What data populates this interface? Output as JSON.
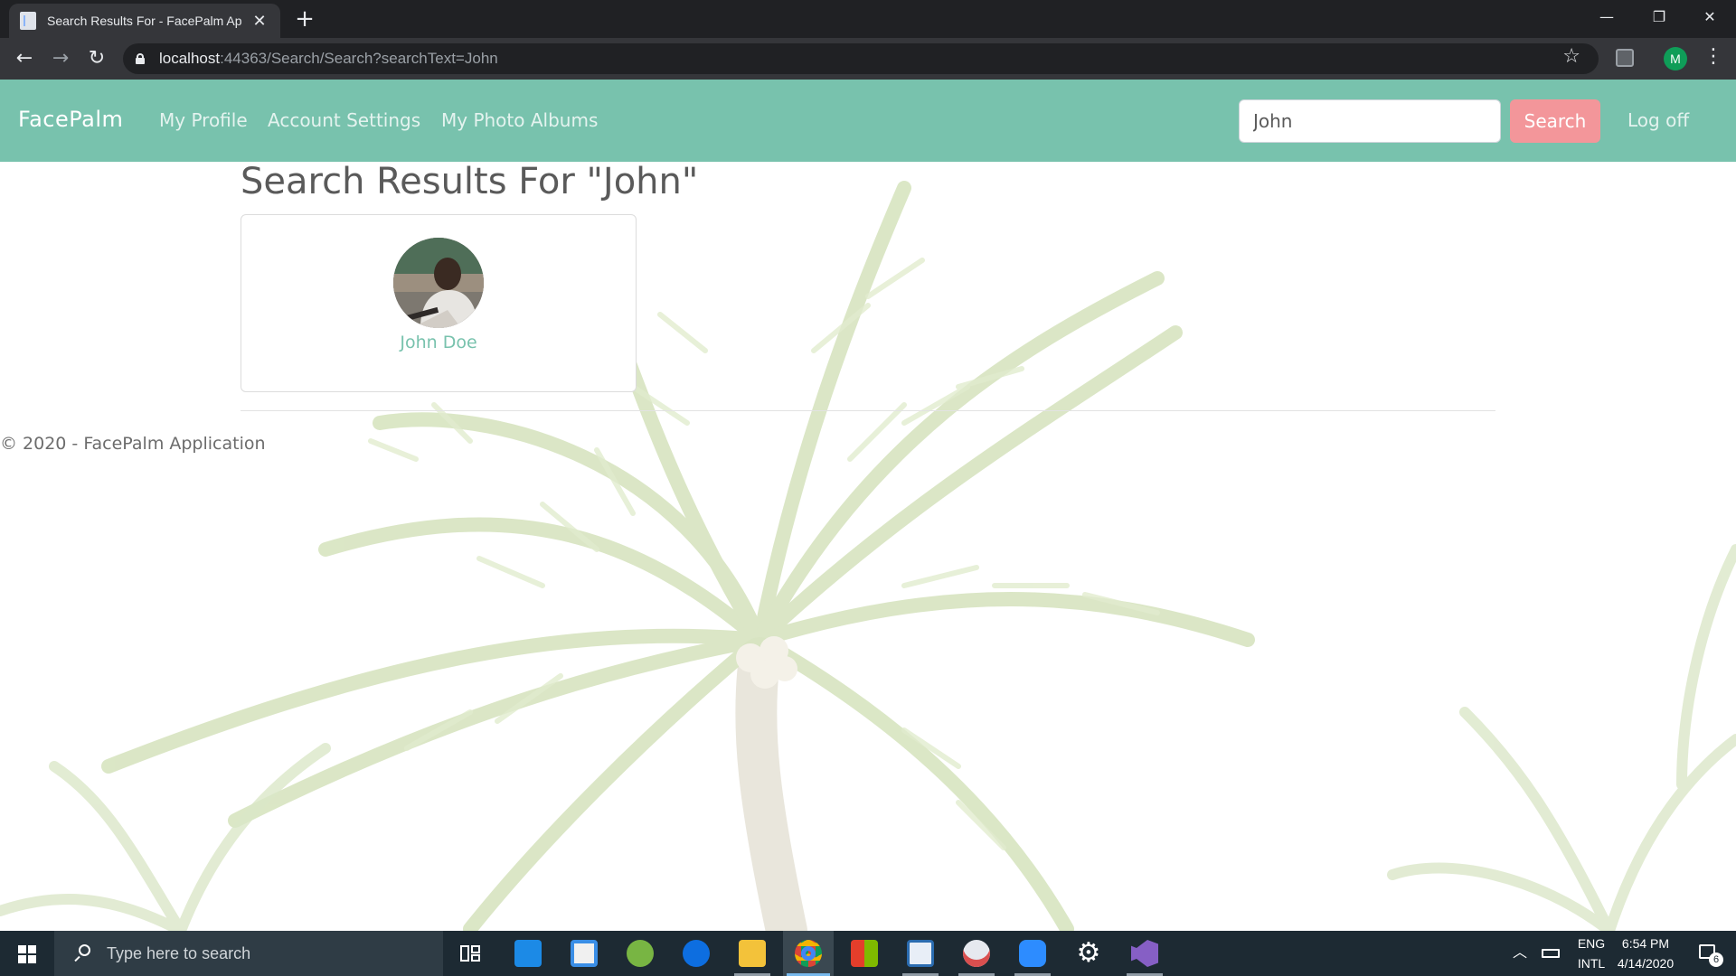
{
  "browser": {
    "tab_title": "Search Results For - FacePalm Ap",
    "url_host": "localhost",
    "url_rest": ":44363/Search/Search?searchText=John",
    "profile_initial": "M"
  },
  "site": {
    "brand": "FacePalm",
    "nav": [
      "My Profile",
      "Account Settings",
      "My Photo Albums"
    ],
    "search_value": "John",
    "search_button": "Search",
    "logoff": "Log off",
    "accent_color": "#78c2ad",
    "button_color": "#f3969a"
  },
  "results": {
    "heading": "Search Results For \"John\"",
    "items": [
      {
        "name": "John Doe"
      }
    ]
  },
  "footer": {
    "text": "© 2020 - FacePalm Application"
  },
  "taskbar": {
    "search_placeholder": "Type here to search",
    "lang_1": "ENG",
    "lang_2": "INTL",
    "time": "6:54 PM",
    "date": "4/14/2020",
    "notifications": "6"
  }
}
